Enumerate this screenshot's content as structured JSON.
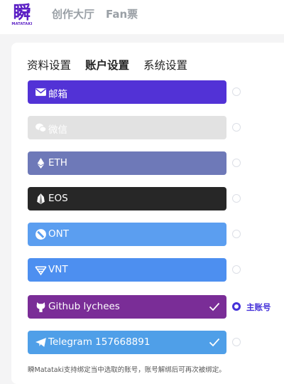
{
  "brand": {
    "glyph": "瞬",
    "name": "MATATAKI"
  },
  "nav": {
    "items": [
      "创作大厅",
      "Fan票"
    ]
  },
  "tabs": [
    "资料设置",
    "账户设置",
    "系统设置"
  ],
  "accounts": [
    {
      "label": "邮箱",
      "color": "#5232d6",
      "icon": "envelope-icon",
      "disabled": false,
      "checked": false
    },
    {
      "label": "微信",
      "color": "#e2e2e2",
      "icon": "wechat-icon",
      "disabled": true,
      "checked": false
    },
    {
      "label": "ETH",
      "color": "#6e79b8",
      "icon": "ethereum-icon",
      "disabled": false,
      "checked": false
    },
    {
      "label": "EOS",
      "color": "#272727",
      "icon": "eos-icon",
      "disabled": false,
      "checked": false
    },
    {
      "label": "ONT",
      "color": "#5b9ef0",
      "icon": "ont-icon",
      "disabled": false,
      "checked": false
    },
    {
      "label": "VNT",
      "color": "#4d8ff0",
      "icon": "vnt-icon",
      "disabled": false,
      "checked": false
    },
    {
      "label": "Github  lychees",
      "color": "#7a2d97",
      "icon": "github-icon",
      "disabled": false,
      "checked": true
    },
    {
      "label": "Telegram  157668891",
      "color": "#4f9fe8",
      "icon": "telegram-icon",
      "disabled": false,
      "checked": true
    }
  ],
  "primary_label": "主账号",
  "footnote": "瞬Matataki支持绑定当中选取的账号，账号解绑后可再次被绑定。"
}
